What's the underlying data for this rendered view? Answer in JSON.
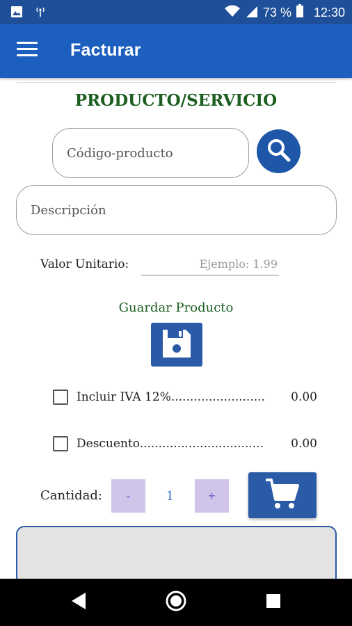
{
  "status_bar": {
    "battery": "73 %",
    "time": "12:30",
    "icons": [
      "image-icon",
      "antenna-icon",
      "wifi-icon",
      "signal-icon",
      "battery-icon"
    ]
  },
  "app_bar": {
    "title": "Facturar",
    "menu_icon": "menu-icon"
  },
  "form": {
    "section_title": "PRODUCTO/SERVICIO",
    "code_placeholder": "Código-producto",
    "description_placeholder": "Descripción",
    "price_label": "Valor Unitario:",
    "price_placeholder": "Ejemplo: 1.99",
    "save_label": "Guardar Producto"
  },
  "options": {
    "iva_label": "Incluir IVA 12%..........................",
    "iva_value": "0.00",
    "discount_label": "Descuento.................................",
    "discount_value": "0.00"
  },
  "quantity": {
    "label": "Cantidad:",
    "minus": "-",
    "value": "1",
    "plus": "+"
  },
  "colors": {
    "app_bar": "#1c5fbf",
    "status_bar": "#1e4f98",
    "button_blue": "#2b5aa6",
    "title_green": "#1b5e20",
    "qty_button": "#d1c4e9"
  }
}
